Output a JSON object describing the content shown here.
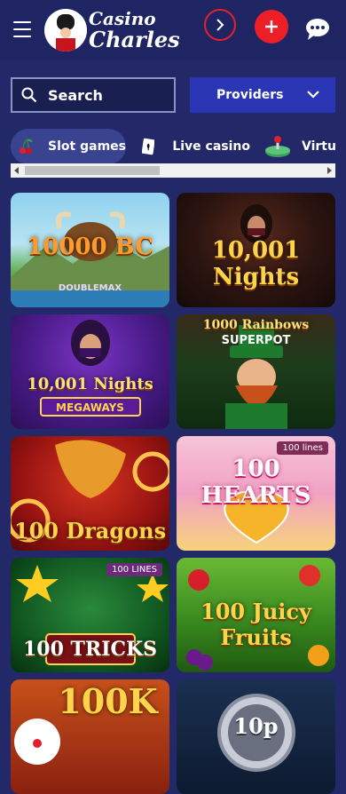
{
  "header": {
    "logo_line1": "Casino",
    "logo_line2": "Charles",
    "menu_icon": "hamburger-icon",
    "login_icon": "chevron-right-icon",
    "register_icon": "plus-icon",
    "chat_icon": "chat-bubble-icon"
  },
  "search": {
    "label": "Search",
    "icon": "search-icon"
  },
  "providers": {
    "label": "Providers",
    "icon": "chevron-down-icon"
  },
  "tabs": [
    {
      "label": "Slot games",
      "icon": "cherries-icon",
      "active": true
    },
    {
      "label": "Live casino",
      "icon": "playing-card-icon",
      "active": false
    },
    {
      "label": "Virtu",
      "icon": "joystick-icon",
      "active": false
    }
  ],
  "games": [
    {
      "title": "10000 BC",
      "subtitle": "DOUBLEMAX"
    },
    {
      "title": "10,001 Nights",
      "subtitle": ""
    },
    {
      "title": "10,001 Nights",
      "subtitle": "MEGAWAYS"
    },
    {
      "title": "1000 Rainbows",
      "subtitle": "SUPERPOT"
    },
    {
      "title": "100 Dragons",
      "subtitle": ""
    },
    {
      "title": "100 HEARTS",
      "subtitle": "",
      "badge": "100 lines"
    },
    {
      "title": "100 TRICKS",
      "subtitle": "",
      "badge": "100 LINES"
    },
    {
      "title": "100 Juicy Fruits",
      "subtitle": ""
    },
    {
      "title": "100K",
      "subtitle": ""
    },
    {
      "title": "10p",
      "subtitle": ""
    }
  ]
}
